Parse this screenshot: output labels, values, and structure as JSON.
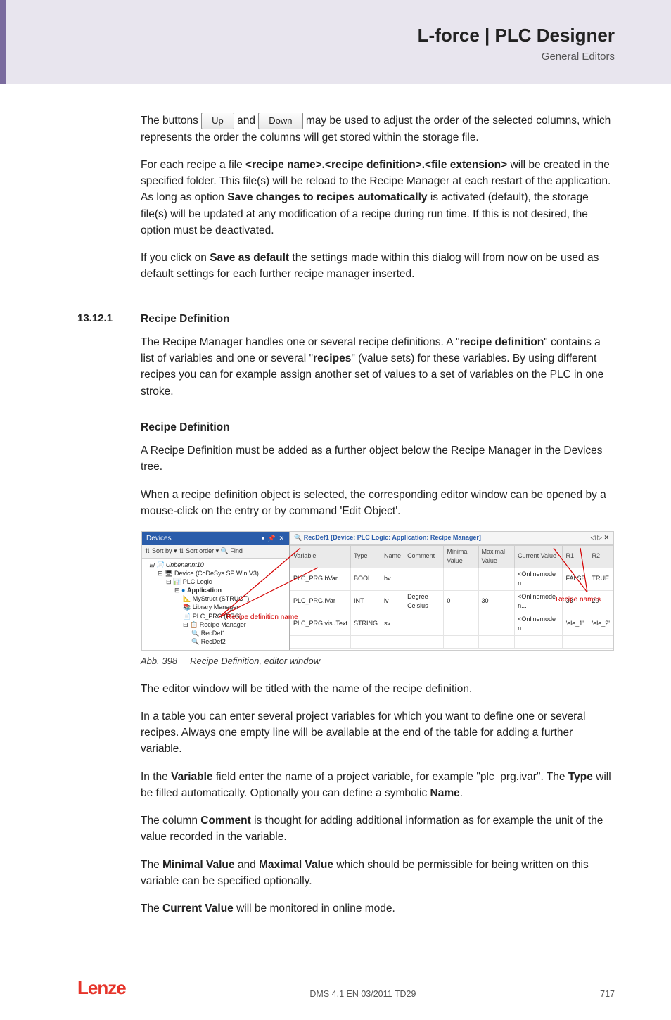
{
  "header": {
    "title": "L-force | PLC Designer",
    "subtitle": "General Editors"
  },
  "buttons": {
    "up": "Up",
    "down": "Down"
  },
  "body": {
    "p1a": "The buttons ",
    "p1b": "and ",
    "p1c": "may be used to adjust the order of the selected columns, which represents the order the columns will get stored within the storage file.",
    "p2a": "For each recipe a file ",
    "p2_bold": "<recipe name>.<recipe definition>.<file extension>",
    "p2b": " will be created in the specified folder. This file(s) will be reload to the Recipe Manager at each restart of the application. As long as option ",
    "p2_bold2": "Save changes to recipes automatically",
    "p2c": " is activated (default), the storage file(s) will be updated at any modification of a recipe during run time. If this is not desired, the option must be deactivated.",
    "p3a": "If you click on ",
    "p3_bold": "Save as default",
    "p3b": " the settings made within this dialog  will from now on be used as default settings for each further recipe manager inserted."
  },
  "section": {
    "num": "13.12.1",
    "title": "Recipe Definition",
    "p1a": "The Recipe Manager handles one or several recipe definitions. A \"",
    "p1_bold1": "recipe definition",
    "p1b": "\" contains a list of variables and one or several \"",
    "p1_bold2": "recipes",
    "p1c": "\" (value sets) for these variables. By using different recipes you can for example assign another set of values to a set of variables on the PLC in one stroke.",
    "sub_head": "Recipe Definition",
    "p2": "A Recipe Definition must be added as a further object below the Recipe Manager in the Devices tree.",
    "p3": "When a recipe definition object is selected, the corresponding editor window can be opened by a mouse-click on the entry or by command 'Edit Object'."
  },
  "figure": {
    "devices_title": "Devices",
    "toolbar": "⇅ Sort by ▾  ⇅ Sort order ▾    🔍 Find",
    "tree": {
      "root": "Unbenannt10",
      "device": "Device (CoDeSys SP Win V3)",
      "plclogic": "PLC Logic",
      "application": "Application",
      "mystruct": "MyStruct (STRUCT)",
      "libmgr": "Library Manager",
      "plcprg": "PLC_PRG (PRG)",
      "recipemgr": "Recipe Manager",
      "recdef1": "RecDef1",
      "recdef2": "RecDef2"
    },
    "tab_prefix": "🔍 ",
    "tab_title": "RecDef1 [Device: PLC Logic: Application: Recipe Manager]",
    "tab_close": "◁ ▷ ✕",
    "headers": [
      "Variable",
      "Type",
      "Name",
      "Comment",
      "Minimal Value",
      "Maximal Value",
      "Current Value",
      "R1",
      "R2"
    ],
    "rows": [
      [
        "PLC_PRG.bVar",
        "BOOL",
        "bv",
        "",
        "",
        "",
        "<Onlinemode n...",
        "FALSE",
        "TRUE"
      ],
      [
        "PLC_PRG.iVar",
        "INT",
        "iv",
        "Degree Celsius",
        "0",
        "30",
        "<Onlinemode n...",
        "33",
        "20"
      ],
      [
        "PLC_PRG.visuText",
        "STRING",
        "sv",
        "",
        "",
        "",
        "<Onlinemode n...",
        "'ele_1'",
        "'ele_2'"
      ]
    ],
    "anno1": "Recipe definition name",
    "anno2": "Recipe names"
  },
  "caption": {
    "num": "Abb. 398",
    "text": "Recipe Definition, editor window"
  },
  "after": {
    "p1": "The editor window will be titled with the name of the recipe definition.",
    "p2": "In a table you can enter several project variables for which you want to define one or several recipes. Always one empty line will be available at the end of the table for adding a further variable.",
    "p3a": "In the ",
    "p3_b1": "Variable",
    "p3b": " field enter the name of a project variable, for example \"plc_prg.ivar\". The ",
    "p3_b2": "Type",
    "p3c": " will be filled automatically. Optionally you can define a symbolic ",
    "p3_b3": "Name",
    "p3d": ".",
    "p4a": "The column ",
    "p4_b": "Comment",
    "p4b": " is thought for adding additional information as for example the unit of the value recorded in the variable.",
    "p5a": "The ",
    "p5_b1": "Minimal Value",
    "p5b": " and ",
    "p5_b2": "Maximal Value",
    "p5c": " which should be permissible for being written on this variable can be specified optionally.",
    "p6a": "The ",
    "p6_b": "Current Value",
    "p6b": " will be monitored in online mode."
  },
  "footer": {
    "logo": "Lenze",
    "center": "DMS 4.1 EN 03/2011 TD29",
    "page": "717"
  }
}
